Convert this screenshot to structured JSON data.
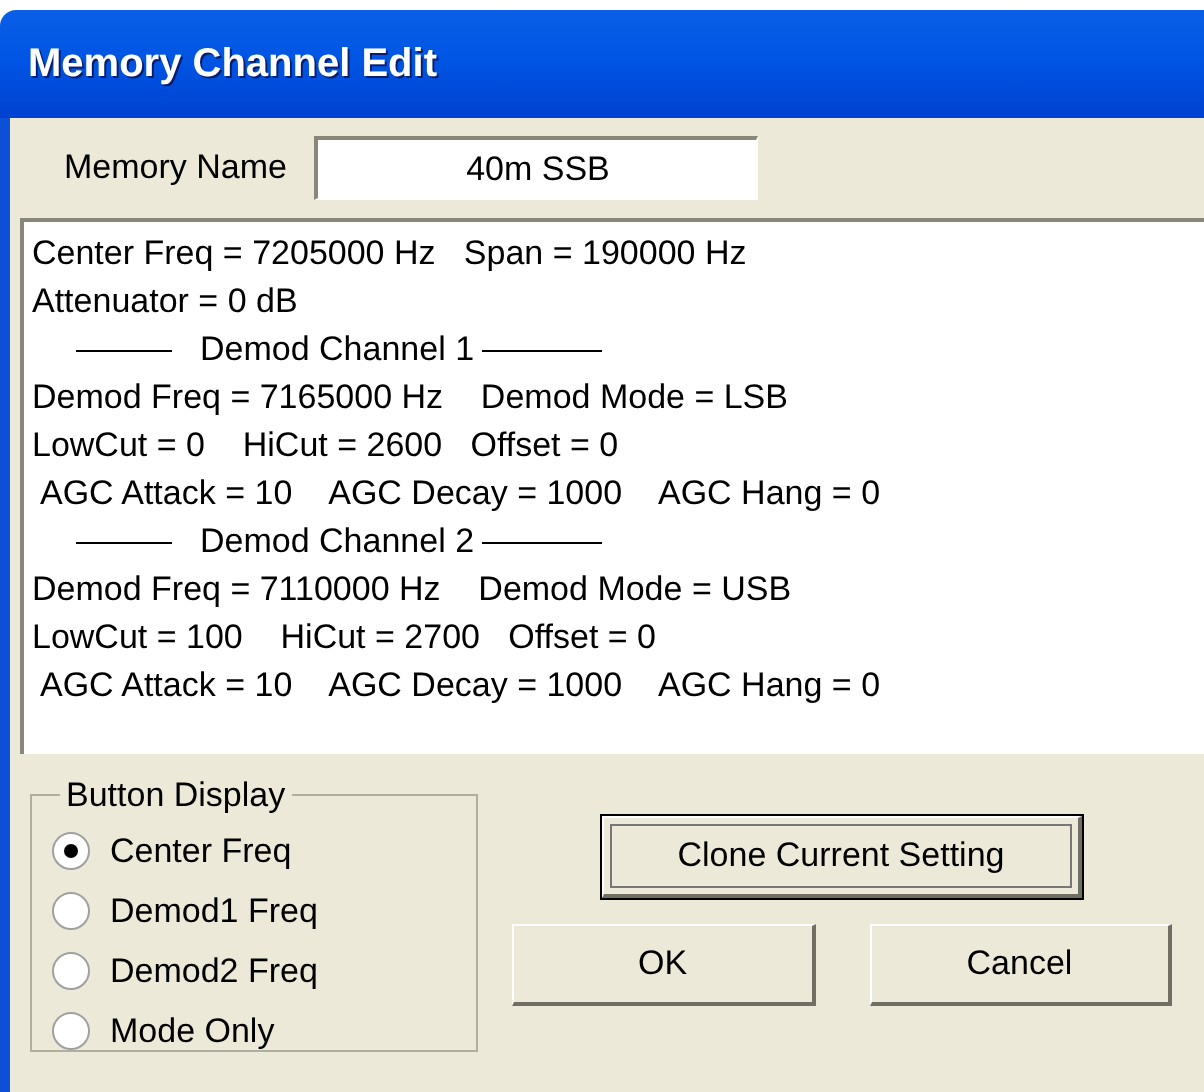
{
  "window": {
    "title": "Memory Channel Edit"
  },
  "memory_name": {
    "label": "Memory Name",
    "value": "40m SSB"
  },
  "settings_lines": [
    {
      "kind": "line",
      "text": "Center Freq = 7205000 Hz   Span = 190000 Hz"
    },
    {
      "kind": "line",
      "text": "Attenuator = 0 dB"
    },
    {
      "kind": "heading",
      "text": "Demod Channel 1"
    },
    {
      "kind": "line",
      "text": "Demod Freq = 7165000 Hz    Demod Mode = LSB"
    },
    {
      "kind": "line",
      "text": "LowCut = 0    HiCut = 2600   Offset = 0"
    },
    {
      "kind": "indented",
      "text": "AGC Attack = 10    AGC Decay = 1000    AGC Hang = 0"
    },
    {
      "kind": "heading",
      "text": "Demod Channel 2"
    },
    {
      "kind": "line",
      "text": "Demod Freq = 7110000 Hz    Demod Mode = USB"
    },
    {
      "kind": "line",
      "text": "LowCut = 100    HiCut = 2700   Offset = 0"
    },
    {
      "kind": "indented",
      "text": "AGC Attack = 10    AGC Decay = 1000    AGC Hang = 0"
    }
  ],
  "button_display": {
    "title": "Button Display",
    "options": [
      {
        "label": "Center Freq",
        "selected": true
      },
      {
        "label": "Demod1 Freq",
        "selected": false
      },
      {
        "label": "Demod2 Freq",
        "selected": false
      },
      {
        "label": "Mode Only",
        "selected": false
      }
    ]
  },
  "buttons": [
    {
      "label": "Clone Current Setting",
      "focused": true
    },
    {
      "label": "OK",
      "focused": false
    },
    {
      "label": "Cancel",
      "focused": false
    }
  ]
}
